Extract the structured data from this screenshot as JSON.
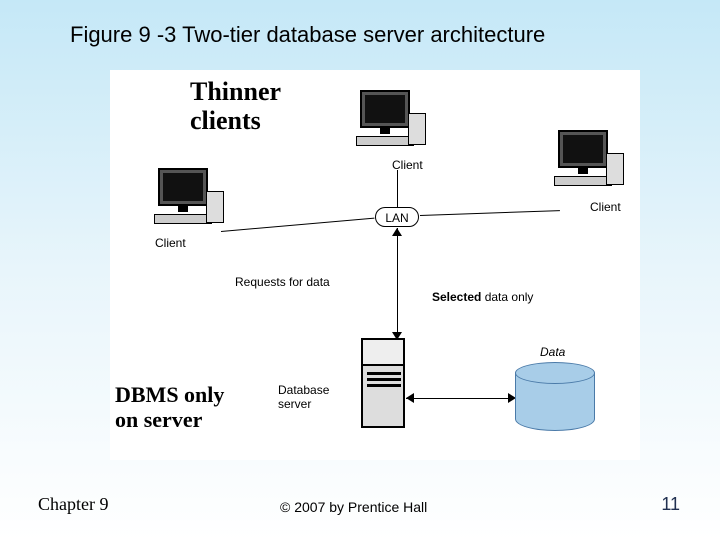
{
  "title": "Figure 9 -3 Two-tier database server architecture",
  "annotations": {
    "thinner": "Thinner\nclients",
    "dbms": "DBMS only\non server"
  },
  "diagram": {
    "clients": [
      "Client",
      "Client",
      "Client"
    ],
    "lan": "LAN",
    "requests": "Requests for data",
    "selected": "Selected data only",
    "db_server": "Database\nserver",
    "data": "Data"
  },
  "footer": {
    "chapter": "Chapter 9",
    "copyright": "© 2007 by Prentice Hall",
    "slide": "11"
  }
}
